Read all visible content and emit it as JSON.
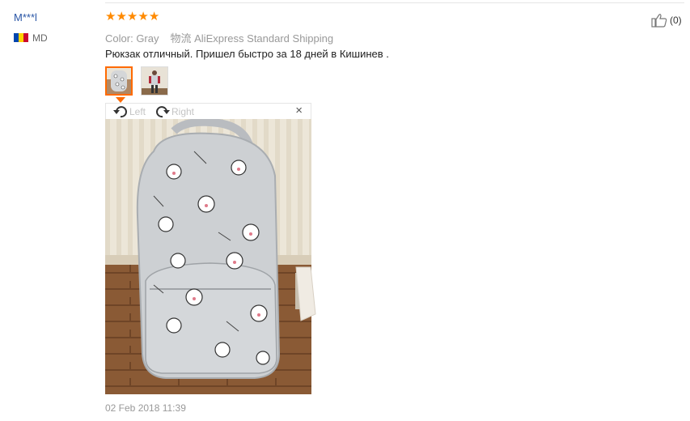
{
  "review": {
    "user_name": "M***l",
    "country_code": "MD",
    "rating": 5,
    "stars": [
      "★",
      "★",
      "★",
      "★",
      "★"
    ],
    "color_label": "Color:",
    "color_value": "Gray",
    "shipping_label": "物流",
    "shipping_value": "AliExpress Standard Shipping",
    "text": "Рюкзак отличный. Пришел быстро за 18 дней в Кишинев .",
    "likes": "(0)",
    "date": "02 Feb 2018 11:39"
  },
  "viewer": {
    "rotate_left": "Left",
    "rotate_right": "Right",
    "close": "×"
  },
  "colors": {
    "star": "#ff8a00",
    "accent": "#ff6a00",
    "user_link": "#2a56a6"
  },
  "icons": {
    "thumbs_up": "thumbs-up-icon",
    "rotate_left": "rotate-left-icon",
    "rotate_right": "rotate-right-icon",
    "close": "close-icon",
    "flag": "moldova-flag-icon"
  }
}
